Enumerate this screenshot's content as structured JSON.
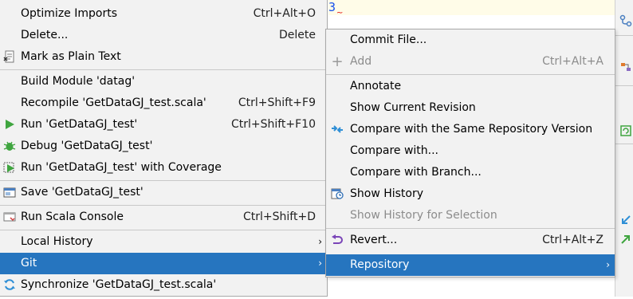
{
  "editor": {
    "line_text": "3",
    "squiggle": "~"
  },
  "main_menu": {
    "items": [
      {
        "label": "Optimize Imports",
        "shortcut": "Ctrl+Alt+O",
        "icon": ""
      },
      {
        "label": "Delete...",
        "shortcut": "Delete",
        "icon": ""
      },
      {
        "label": "Mark as Plain Text",
        "shortcut": "",
        "icon": "mark-plain-text-icon"
      },
      {
        "label": "Build Module 'datag'",
        "shortcut": "",
        "icon": ""
      },
      {
        "label": "Recompile 'GetDataGJ_test.scala'",
        "shortcut": "Ctrl+Shift+F9",
        "icon": ""
      },
      {
        "label": "Run 'GetDataGJ_test'",
        "shortcut": "Ctrl+Shift+F10",
        "icon": "run-icon"
      },
      {
        "label": "Debug 'GetDataGJ_test'",
        "shortcut": "",
        "icon": "debug-icon"
      },
      {
        "label": "Run 'GetDataGJ_test' with Coverage",
        "shortcut": "",
        "icon": "coverage-icon"
      },
      {
        "label": "Save 'GetDataGJ_test'",
        "shortcut": "",
        "icon": "save-config-icon"
      },
      {
        "label": "Run Scala Console",
        "shortcut": "Ctrl+Shift+D",
        "icon": "console-icon"
      },
      {
        "label": "Local History",
        "shortcut": "",
        "icon": ""
      },
      {
        "label": "Git",
        "shortcut": "",
        "icon": ""
      },
      {
        "label": "Synchronize 'GetDataGJ_test.scala'",
        "shortcut": "",
        "icon": "sync-icon"
      }
    ]
  },
  "git_menu": {
    "items": [
      {
        "label": "Commit File...",
        "shortcut": ""
      },
      {
        "label": "Add",
        "shortcut": "Ctrl+Alt+A"
      },
      {
        "label": "Annotate",
        "shortcut": ""
      },
      {
        "label": "Show Current Revision",
        "shortcut": ""
      },
      {
        "label": "Compare with the Same Repository Version",
        "shortcut": ""
      },
      {
        "label": "Compare with...",
        "shortcut": ""
      },
      {
        "label": "Compare with Branch...",
        "shortcut": ""
      },
      {
        "label": "Show History",
        "shortcut": ""
      },
      {
        "label": "Show History for Selection",
        "shortcut": ""
      },
      {
        "label": "Revert...",
        "shortcut": "Ctrl+Alt+Z"
      },
      {
        "label": "Repository",
        "shortcut": ""
      }
    ]
  },
  "glyphs": {
    "submenu_arrow": "›"
  },
  "colors": {
    "selection": "#2675bf",
    "menu_bg": "#f2f2f2",
    "run_green": "#3fa53f",
    "disabled": "#8c8c8c"
  }
}
